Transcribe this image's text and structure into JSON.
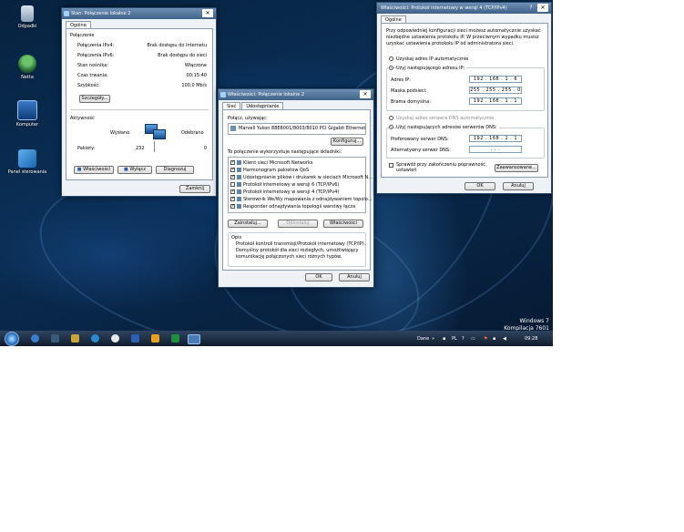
{
  "desktop": {
    "icons": [
      {
        "label": "Odpadki"
      },
      {
        "label": "Netta"
      },
      {
        "label": "Komputer"
      },
      {
        "label": "Panel sterowania"
      }
    ],
    "watermark": {
      "line1": "Windows 7",
      "line2": "Kompilacja 7601"
    }
  },
  "status_window": {
    "title": "Stan: Połączenie lokalne 2",
    "tab": "Ogólne",
    "section_connection": "Połączenie",
    "rows": [
      {
        "label": "Połączenia IPv4:",
        "value": "Brak dostępu do Internetu"
      },
      {
        "label": "Połączenia IPv6:",
        "value": "Brak dostępu do sieci"
      },
      {
        "label": "Stan nośnika:",
        "value": "Włączone"
      },
      {
        "label": "Czas trwania:",
        "value": "00:15:40"
      },
      {
        "label": "Szybkość:",
        "value": "100,0 Mb/s"
      }
    ],
    "details_button": "Szczegóły...",
    "section_activity": "Aktywność",
    "sent_label": "Wysłano",
    "received_label": "Odebrano",
    "packets_label": "Pakiety:",
    "packets_sent": "232",
    "packets_received": "0",
    "properties_button": "Właściwości",
    "disable_button": "Wyłącz",
    "diagnose_button": "Diagnozuj",
    "close_button": "Zamknij"
  },
  "props_window": {
    "title": "Właściwości: Połączenie lokalne 2",
    "tabs": [
      "Sieć",
      "Udostępnianie"
    ],
    "connect_using": "Połącz, używając:",
    "adapter": "Marvell Yukon 88E8001/8003/8010 PCI Gigabit Ethernet",
    "configure_button": "Konfiguruj...",
    "components_label": "To połączenie wykorzystuje następujące składniki:",
    "components": [
      {
        "label": "Klient sieci Microsoft Networks",
        "checked": true
      },
      {
        "label": "Harmonogram pakietów QoS",
        "checked": true
      },
      {
        "label": "Udostępnianie plików i drukarek w sieciach Microsoft N...",
        "checked": true
      },
      {
        "label": "Protokół internetowy w wersji 6 (TCP/IPv6)",
        "checked": false
      },
      {
        "label": "Protokół internetowy w wersji 4 (TCP/IPv4)",
        "checked": true
      },
      {
        "label": "Sterownik We/Wy mapowania z odnajdywaniem topolo...",
        "checked": true
      },
      {
        "label": "Responder odnajdywania topologii warstwy łącza",
        "checked": true
      }
    ],
    "install_button": "Zainstaluj...",
    "uninstall_button": "Odinstaluj",
    "properties_button": "Właściwości",
    "description_heading": "Opis",
    "description": [
      "Protokół kontroli transmisji/Protokół internetowy (TCP/IP).",
      "Domyślny protokół dla sieci rozległych, umożliwiający",
      "komunikację połączonych sieci różnych typów."
    ],
    "ok_button": "OK",
    "cancel_button": "Anuluj"
  },
  "ipv4_window": {
    "title": "Właściwości: Protokół internetowy w wersji 4 (TCP/IPv4)",
    "help": "?",
    "tab": "Ogólne",
    "intro": [
      "Przy odpowiedniej konfiguracji sieci możesz automatycznie uzyskać",
      "niezbędne ustawienia protokołu IP. W przeciwnym wypadku musisz",
      "uzyskać ustawienia protokołu IP od administratora sieci."
    ],
    "auto_ip": "Uzyskaj adres IP automatycznie",
    "manual_ip": "Użyj następującego adresu IP:",
    "ip_label": "Adres IP:",
    "ip_value": "192 . 168 .  1  .  6",
    "mask_label": "Maska podsieci:",
    "mask_value": "255 . 255 . 255 .  0",
    "gateway_label": "Brama domyślna:",
    "gateway_value": "192 . 168 .  1  .  1",
    "auto_dns": "Uzyskaj adres serwera DNS automatycznie",
    "manual_dns": "Użyj następujących adresów serwerów DNS:",
    "pref_dns_label": "Preferowany serwer DNS:",
    "pref_dns_value": "192 . 168 .  1  .  1",
    "alt_dns_label": "Alternatywny serwer DNS:",
    "alt_dns_value": ".     .     .",
    "validate_label": [
      "Sprawdź przy zakończeniu poprawność",
      "ustawień"
    ],
    "advanced_button": "Zaawansowane...",
    "ok_button": "OK",
    "cancel_button": "Anuluj"
  },
  "taskbar": {
    "lang": "Dane",
    "kb": "PL",
    "time": "09:28"
  }
}
